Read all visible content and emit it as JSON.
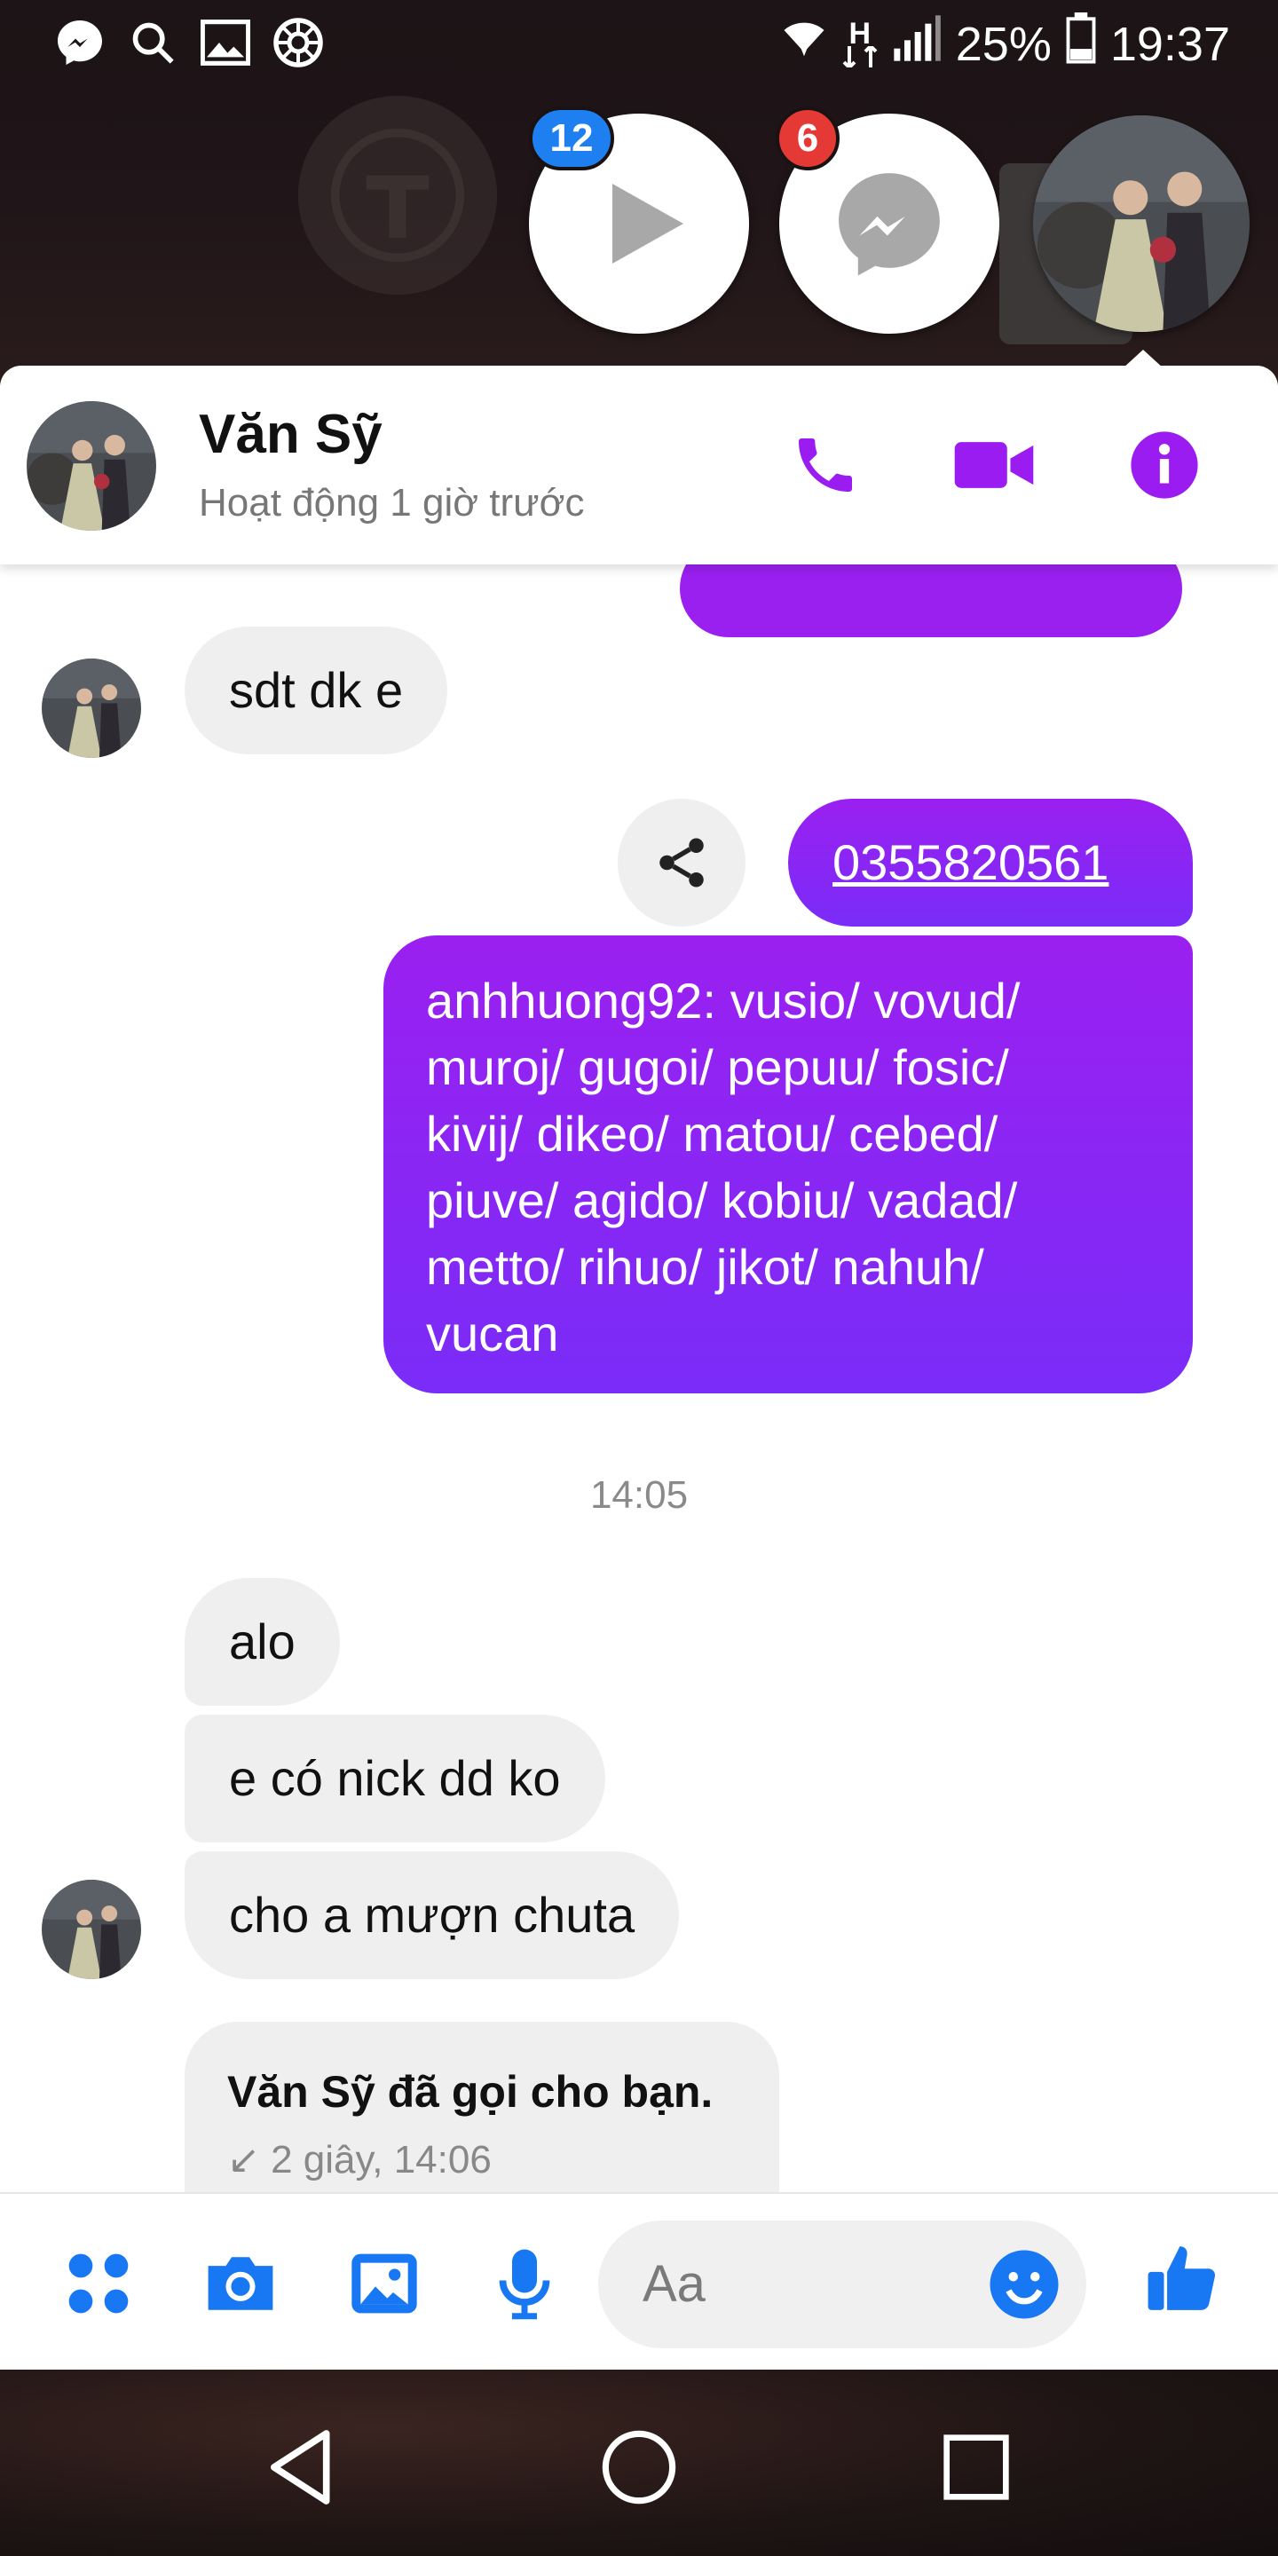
{
  "status_bar": {
    "battery": "25%",
    "time": "19:37",
    "network": "H",
    "icons": [
      "messenger-icon",
      "search-icon",
      "gallery-icon",
      "aperture-icon",
      "wifi-icon",
      "network-icon",
      "signal-icon",
      "battery-icon"
    ]
  },
  "chat_heads": {
    "video_badge": "12",
    "messenger_badge": "6"
  },
  "header": {
    "name": "Văn Sỹ",
    "status": "Hoạt động 1 giờ trước",
    "accent": "#9b1cf0"
  },
  "messages": {
    "in_1": "sdt dk e",
    "out_phone": "0355820561",
    "out_list": [
      "anhhuong92: vusio/ vovud/",
      "muroj/ gugoi/ pepuu/ fosic/",
      "kivij/ dikeo/ matou/ cebed/",
      "piuve/ agido/ kobiu/ vadad/",
      "metto/ rihuo/ jikot/ nahuh/",
      "vucan"
    ],
    "timestamp": "14:05",
    "in_2": "alo",
    "in_3": "e có nick dd ko",
    "in_4": "cho a mượn chuta",
    "call_title": "Văn Sỹ đã gọi cho bạn.",
    "call_sub": "↙ 2 giây, 14:06"
  },
  "composer": {
    "placeholder": "Aa",
    "accent": "#1877f2"
  }
}
